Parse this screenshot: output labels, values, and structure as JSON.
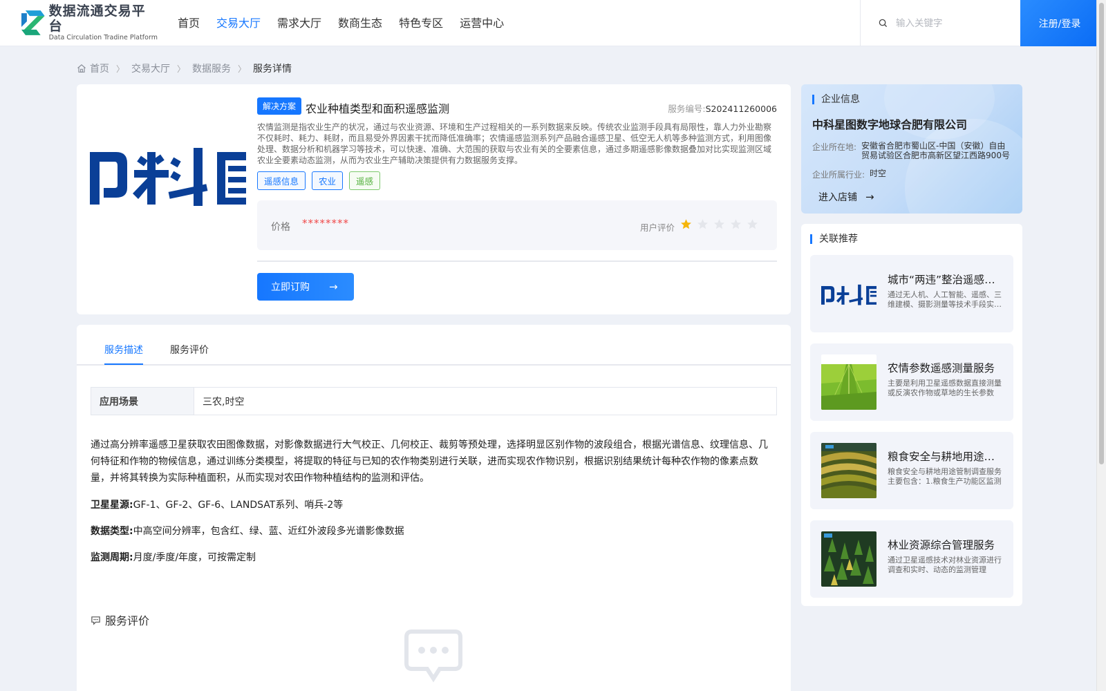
{
  "header": {
    "logo_cn": "数据流通交易平台",
    "logo_en": "Data Circulation Tradine Platform",
    "nav": [
      "首页",
      "交易大厅",
      "需求大厅",
      "数商生态",
      "特色专区",
      "运营中心"
    ],
    "nav_active": "交易大厅",
    "search_placeholder": "输入关键字",
    "login_label": "注册/登录"
  },
  "breadcrumb": [
    "首页",
    "交易大厅",
    "数据服务",
    "服务详情"
  ],
  "product": {
    "badge": "解决方案",
    "title": "农业种植类型和面积遥感监测",
    "service_no_label": "服务编号:",
    "service_no": "S202411260006",
    "description": "农情监测是指农业生产的状况，通过与农业资源、环境和生产过程相关的一系列数据来反映。传统农业监测手段具有局限性，靠人力外业勘察不仅耗时、耗力、耗财，而且易受外界因素干扰而降低准确率；农情遥感监测系列产品融合遥感卫星、低空无人机等多种监测方式，利用图像处理、数据分析和机器学习等技术，可以快速、准确、大范围的获取与农业有关的全要素信息，通过多期遥感影像数据叠加对比实现监测区域农业全要素动态监测，从而为农业生产辅助决策提供有力数据服务支撑。",
    "tags": [
      "遥感信息",
      "农业",
      "遥感"
    ],
    "price_label": "价格",
    "price_value": "********",
    "rating_label": "用户评价",
    "rating": 1,
    "rating_max": 5,
    "order_label": "立即订购"
  },
  "enterprise": {
    "heading": "企业信息",
    "name": "中科星图数字地球合肥有限公司",
    "location_label": "企业所在地:",
    "location": "安徽省合肥市蜀山区-中国（安徽）自由贸易试验区合肥市高新区望江西路900号",
    "industry_label": "企业所属行业:",
    "industry": "时空",
    "store_link": "进入店铺"
  },
  "related": {
    "heading": "关联推荐",
    "items": [
      {
        "title": "城市“两违”整治遥感监测服务",
        "desc": "通过无人机、人工智能、遥感、三维建模、摄影测量等技术手段实现城市违建违章整治",
        "thumb": "logo"
      },
      {
        "title": "农情参数遥感测量服务",
        "desc": "主要是利用卫星遥感数据直接测量或反演农作物或草地的生长参数",
        "thumb": "field"
      },
      {
        "title": "粮食安全与耕地用途管制调查服务",
        "desc": "粮食安全与耕地用途管制调查服务主要包含：1.粮食生产功能区监测",
        "thumb": "terrace"
      },
      {
        "title": "林业资源综合管理服务",
        "desc": "通过卫星遥感技术对林业资源进行调查和实时、动态的监测管理",
        "thumb": "forest"
      }
    ]
  },
  "detail": {
    "tabs": [
      "服务描述",
      "服务评价"
    ],
    "active_tab": "服务描述",
    "scene_label": "应用场景",
    "scene_value": "三农,时空",
    "body": "通过高分辨率遥感卫星获取农田图像数据，对影像数据进行大气校正、几何校正、裁剪等预处理，选择明显区别作物的波段组合，根据光谱信息、纹理信息、几何特征和作物的物候信息，通过训练分类模型，将提取的特征与已知的农作物类别进行关联，进而实现农作物识别，根据识别结果统计每种农作物的像素点数量，并将其转换为实际种植面积，从而实现对农田作物种植结构的监测和评估。",
    "satellite_label": "卫星星源:",
    "satellite_value": "GF-1、GF-2、GF-6、LANDSAT系列、哨兵-2等",
    "datatype_label": "数据类型:",
    "datatype_value": "中高空间分辨率，包含红、绿、蓝、近红外波段多光谱影像数据",
    "period_label": "监测周期:",
    "period_value": "月度/季度/年度，可按需定制",
    "review_heading": "服务评价"
  },
  "colors": {
    "accent": "#1677ff",
    "price": "#f04848",
    "star_on": "#f5b50a",
    "star_off": "#e4e6eb"
  }
}
